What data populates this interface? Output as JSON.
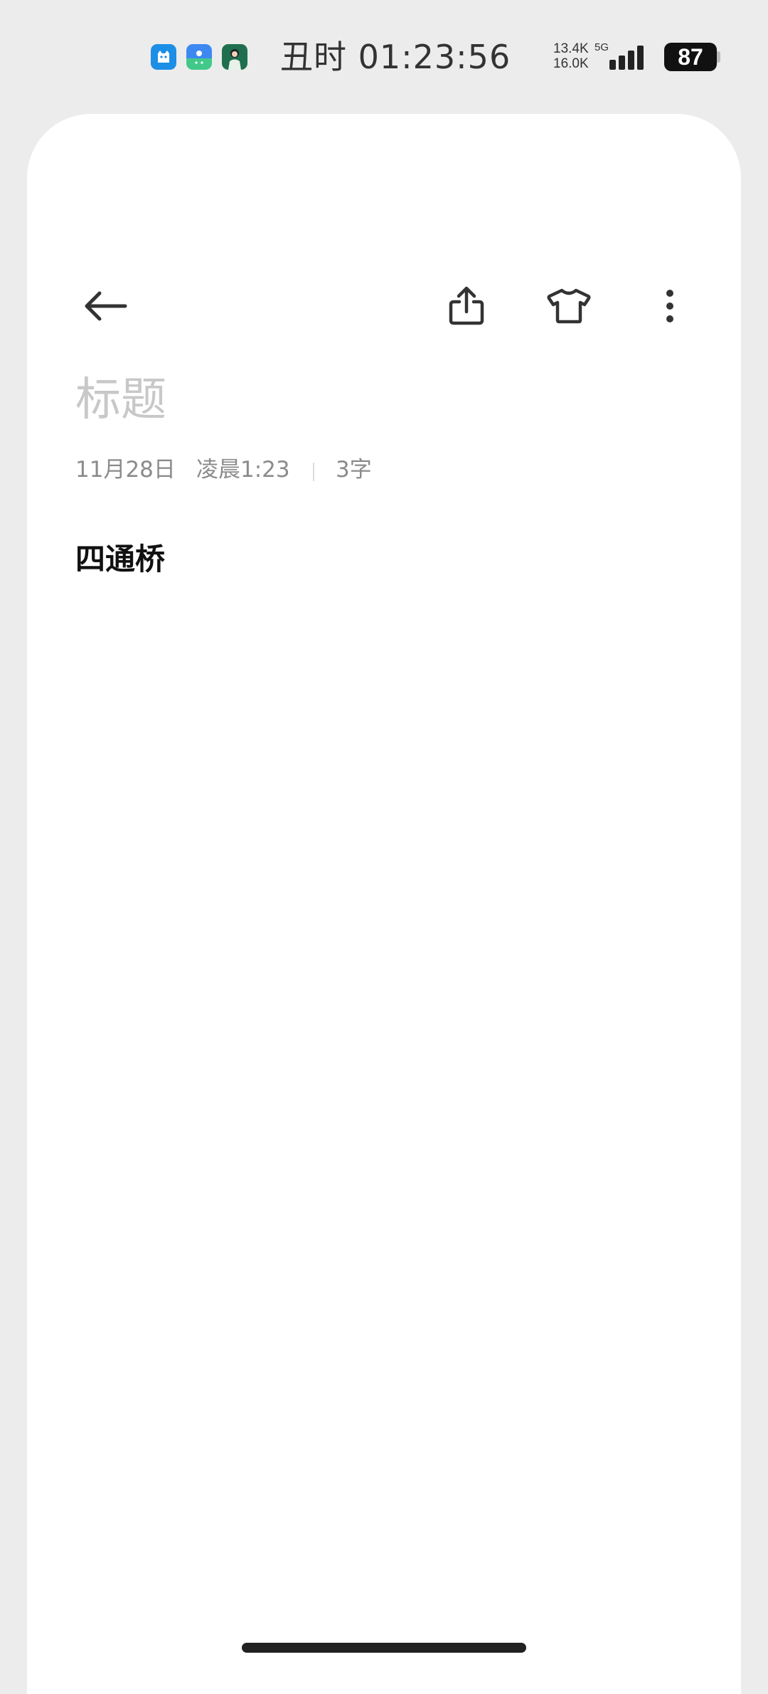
{
  "status_bar": {
    "notification_icons": [
      "cat-app-icon",
      "robot-app-icon",
      "avatar-app-icon"
    ],
    "time": "丑时 01:23:56",
    "net_speed_up": "13.4K",
    "net_speed_down": "16.0K",
    "network_type": "5G",
    "signal_bars": 4,
    "battery_level": "87"
  },
  "toolbar": {
    "back_icon": "arrow-left-icon",
    "share_icon": "share-icon",
    "theme_icon": "shirt-icon",
    "more_icon": "more-vertical-icon"
  },
  "note": {
    "title_placeholder": "标题",
    "date": "11月28日",
    "time": "凌晨1:23",
    "word_count": "3字",
    "body": "四通桥"
  },
  "colors": {
    "background": "#ececec",
    "card": "#ffffff",
    "placeholder": "#c8c8c8",
    "meta_text": "#8b8b8b",
    "icon": "#333333"
  }
}
